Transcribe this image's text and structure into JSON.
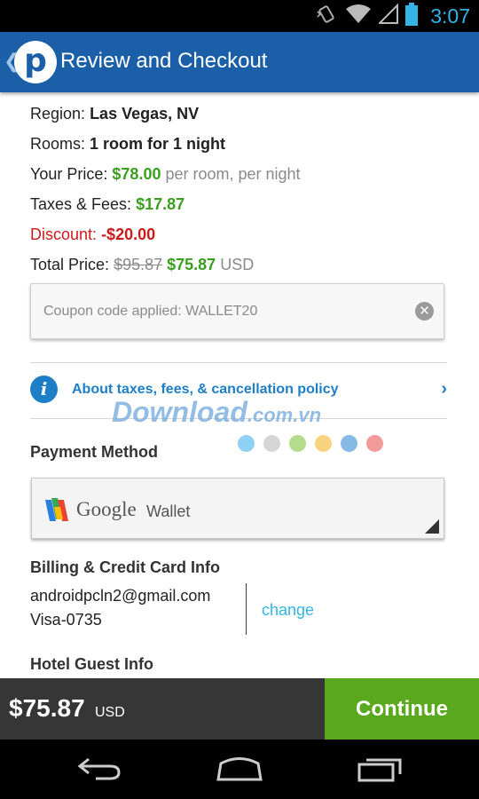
{
  "status_bar": {
    "time": "3:07",
    "icons": [
      "vibrate-icon",
      "wifi-icon",
      "signal-icon",
      "battery-icon"
    ]
  },
  "app_bar": {
    "logo_letter": "p",
    "title": "Review and Checkout"
  },
  "details": {
    "region_label": "Region:",
    "region_value": "Las Vegas, NV",
    "rooms_label": "Rooms:",
    "rooms_value": "1 room for 1 night",
    "price_label": "Your Price:",
    "price_value": "$78.00",
    "price_suffix": "per room, per night",
    "taxes_label": "Taxes & Fees:",
    "taxes_value": "$17.87",
    "discount_label": "Discount:",
    "discount_value": "-$20.00",
    "total_label": "Total Price:",
    "total_old": "$95.87",
    "total_new": "$75.87",
    "total_currency": "USD"
  },
  "coupon": {
    "placeholder": "Coupon code applied: WALLET20"
  },
  "policy": {
    "link_text": "About taxes, fees, & cancellation policy"
  },
  "watermark": {
    "text": "Download",
    "suffix": ".com.vn",
    "dot_colors": [
      "#8fd0f5",
      "#d5d5d5",
      "#b5dc8e",
      "#f7d37e",
      "#86b9e6",
      "#f29a9a"
    ]
  },
  "payment": {
    "section_title": "Payment Method",
    "brand_google": "Google",
    "brand_wallet": "Wallet"
  },
  "billing": {
    "section_title": "Billing & Credit Card Info",
    "email": "androidpcln2@gmail.com",
    "card": "Visa-0735",
    "change_label": "change"
  },
  "next_section": {
    "title": "Hotel Guest Info"
  },
  "bottom_bar": {
    "price": "$75.87",
    "currency": "USD",
    "continue_label": "Continue"
  },
  "colors": {
    "app_bar": "#1a5fa8",
    "price_green": "#3a9e1e",
    "discount_red": "#cc1a1a",
    "link_blue": "#33b5e5",
    "continue_green": "#5aa81e"
  }
}
